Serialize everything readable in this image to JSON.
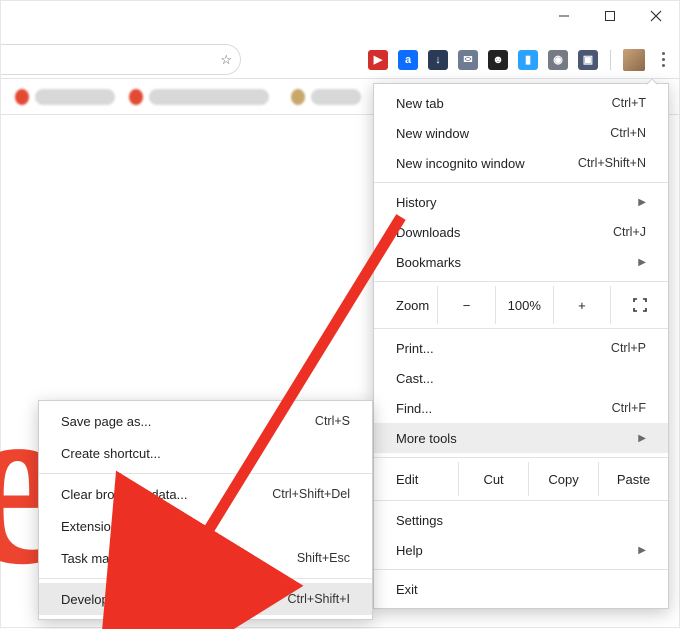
{
  "window_controls": {
    "min": "minimize",
    "max": "maximize",
    "close": "close"
  },
  "toolbar": {
    "star": "☆",
    "extensions": [
      {
        "name": "looper",
        "bg": "#d32f2f",
        "fg": "#fff",
        "glyph": "▶"
      },
      {
        "name": "amazon",
        "bg": "#0d6efd",
        "fg": "#fff",
        "glyph": "a"
      },
      {
        "name": "png-dl",
        "bg": "#2b3a55",
        "fg": "#fff",
        "glyph": "↓"
      },
      {
        "name": "inbox",
        "bg": "#6f7b91",
        "fg": "#fff",
        "glyph": "✉"
      },
      {
        "name": "stylish",
        "bg": "#222",
        "fg": "#fff",
        "glyph": "☻"
      },
      {
        "name": "tag",
        "bg": "#2aa3ff",
        "fg": "#fff",
        "glyph": "▮"
      },
      {
        "name": "screenshot",
        "bg": "#757a84",
        "fg": "#fff",
        "glyph": "◉"
      },
      {
        "name": "reader",
        "bg": "#4a5874",
        "fg": "#fff",
        "glyph": "▣"
      }
    ]
  },
  "menu": {
    "new_tab": {
      "label": "New tab",
      "shortcut": "Ctrl+T"
    },
    "new_window": {
      "label": "New window",
      "shortcut": "Ctrl+N"
    },
    "new_incognito": {
      "label": "New incognito window",
      "shortcut": "Ctrl+Shift+N"
    },
    "history": {
      "label": "History"
    },
    "downloads": {
      "label": "Downloads",
      "shortcut": "Ctrl+J"
    },
    "bookmarks": {
      "label": "Bookmarks"
    },
    "zoom": {
      "label": "Zoom",
      "minus": "−",
      "pct": "100%",
      "plus": "+",
      "full": "⛶"
    },
    "print": {
      "label": "Print...",
      "shortcut": "Ctrl+P"
    },
    "cast": {
      "label": "Cast..."
    },
    "find": {
      "label": "Find...",
      "shortcut": "Ctrl+F"
    },
    "more_tools": {
      "label": "More tools"
    },
    "edit": {
      "label": "Edit",
      "cut": "Cut",
      "copy": "Copy",
      "paste": "Paste"
    },
    "settings": {
      "label": "Settings"
    },
    "help": {
      "label": "Help"
    },
    "exit": {
      "label": "Exit"
    }
  },
  "submenu": {
    "save_page": {
      "label": "Save page as...",
      "shortcut": "Ctrl+S"
    },
    "create_shortcut": {
      "label": "Create shortcut..."
    },
    "clear_data": {
      "label": "Clear browsing data...",
      "shortcut": "Ctrl+Shift+Del"
    },
    "extensions": {
      "label": "Extensions"
    },
    "task_manager": {
      "label": "Task manager",
      "shortcut": "Shift+Esc"
    },
    "developer_tools": {
      "label": "Developer tools",
      "shortcut": "Ctrl+Shift+I"
    }
  }
}
